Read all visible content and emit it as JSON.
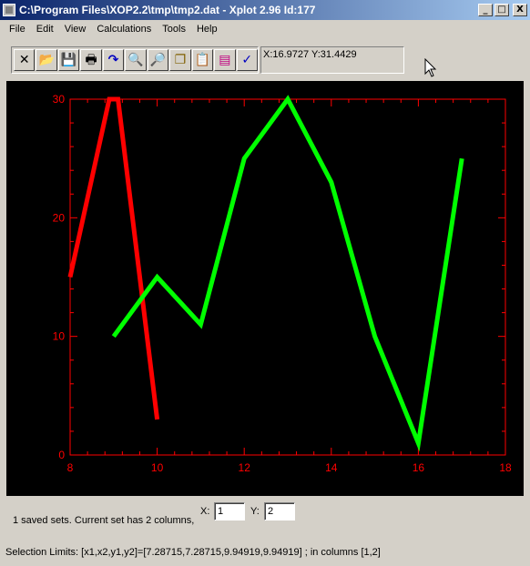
{
  "window": {
    "title": "C:\\Program Files\\XOP2.2\\tmp\\tmp2.dat - Xplot 2.96 Id:177",
    "minimize": "_",
    "maximize": "□",
    "close": "X"
  },
  "menu": [
    {
      "label": "File"
    },
    {
      "label": "Edit"
    },
    {
      "label": "View"
    },
    {
      "label": "Calculations"
    },
    {
      "label": "Tools"
    },
    {
      "label": "Help"
    }
  ],
  "toolbar": [
    {
      "icon": "exit-icon",
      "glyph": "✕"
    },
    {
      "icon": "open-folder-icon",
      "glyph": "📂"
    },
    {
      "icon": "save-icon",
      "glyph": "💾"
    },
    {
      "icon": "print-icon",
      "glyph": "🖶"
    },
    {
      "icon": "refresh-icon",
      "glyph": "↷"
    },
    {
      "icon": "zoom-out-icon",
      "glyph": "🔍"
    },
    {
      "icon": "zoom-in-icon",
      "glyph": "🔎"
    },
    {
      "icon": "copy-icon",
      "glyph": "❐"
    },
    {
      "icon": "clipboard-icon",
      "glyph": "📋"
    },
    {
      "icon": "chart-icon",
      "glyph": "▤"
    },
    {
      "icon": "check-icon",
      "glyph": "✓"
    }
  ],
  "coord_display": "X:16.9727 Y:31.4429",
  "status": {
    "sets_text": "1  saved sets. Current set has  2  columns,",
    "x_label": "X:",
    "x_value": "1",
    "y_label": "Y:",
    "y_value": "2",
    "selection_limits": "Selection Limits: [x1,x2,y1,y2]=[7.28715,7.28715,9.94919,9.94919] ; in columns [1,2]"
  },
  "chart_data": {
    "type": "line",
    "background": "#000000",
    "axis_color": "#ff0000",
    "xlim": [
      8,
      18
    ],
    "ylim": [
      0,
      30
    ],
    "xticks": [
      8,
      10,
      12,
      14,
      16,
      18
    ],
    "yticks": [
      0,
      10,
      20,
      30
    ],
    "xtick_labels": [
      "8",
      "10",
      "12",
      "14",
      "16",
      "18"
    ],
    "ytick_labels": [
      "0",
      "10",
      "20",
      "30"
    ],
    "series": [
      {
        "color": "#ff0000",
        "x": [
          8,
          8.9,
          9.1,
          10
        ],
        "y": [
          15,
          30,
          30,
          3
        ]
      },
      {
        "color": "#00ff00",
        "x": [
          9,
          10,
          11,
          12,
          13,
          14,
          15,
          16,
          17
        ],
        "y": [
          10,
          15,
          11,
          25,
          30,
          23,
          10,
          1,
          25
        ]
      }
    ]
  }
}
